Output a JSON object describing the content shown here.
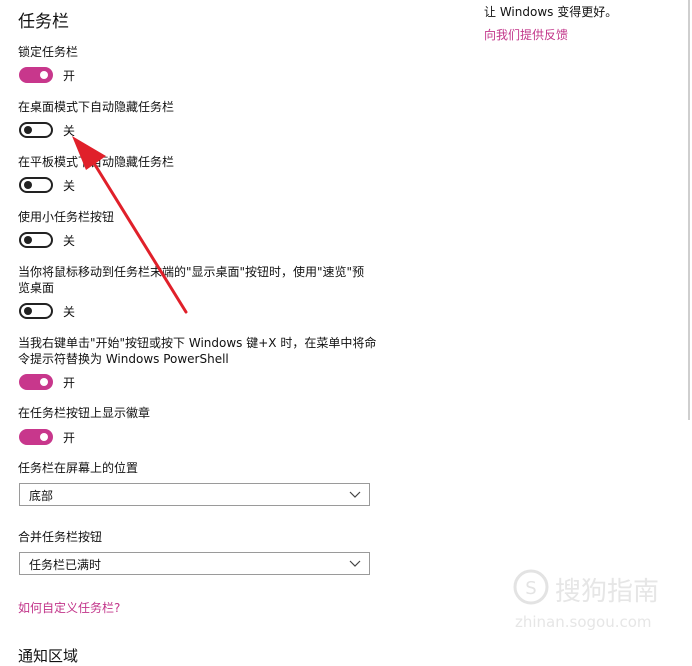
{
  "section_title": "任务栏",
  "settings": [
    {
      "label": "锁定任务栏",
      "state": "开",
      "on": true
    },
    {
      "label": "在桌面模式下自动隐藏任务栏",
      "state": "关",
      "on": false
    },
    {
      "label": "在平板模式下自动隐藏任务栏",
      "state": "关",
      "on": false
    },
    {
      "label": "使用小任务栏按钮",
      "state": "关",
      "on": false
    },
    {
      "label_line1": "当你将鼠标移动到任务栏末端的\"显示桌面\"按钮时，使用\"速览\"预",
      "label_line2": "览桌面",
      "state": "关",
      "on": false
    },
    {
      "label_line1": "当我右键单击\"开始\"按钮或按下 Windows 键+X 时，在菜单中将命",
      "label_line2": "令提示符替换为 Windows PowerShell",
      "state": "开",
      "on": true
    },
    {
      "label": "在任务栏按钮上显示徽章",
      "state": "开",
      "on": true
    }
  ],
  "position": {
    "label": "任务栏在屏幕上的位置",
    "value": "底部"
  },
  "combine": {
    "label": "合并任务栏按钮",
    "value": "任务栏已满时"
  },
  "customize_link": "如何自定义任务栏?",
  "next_section": "通知区域",
  "side": {
    "text": "让 Windows 变得更好。",
    "feedback_link": "向我们提供反馈"
  },
  "watermark": {
    "brand": "搜狗指南",
    "url": "zhinan.sogou.com"
  },
  "colors": {
    "accent": "#c8378c",
    "link": "#c2358a",
    "arrow": "#e0202a"
  }
}
